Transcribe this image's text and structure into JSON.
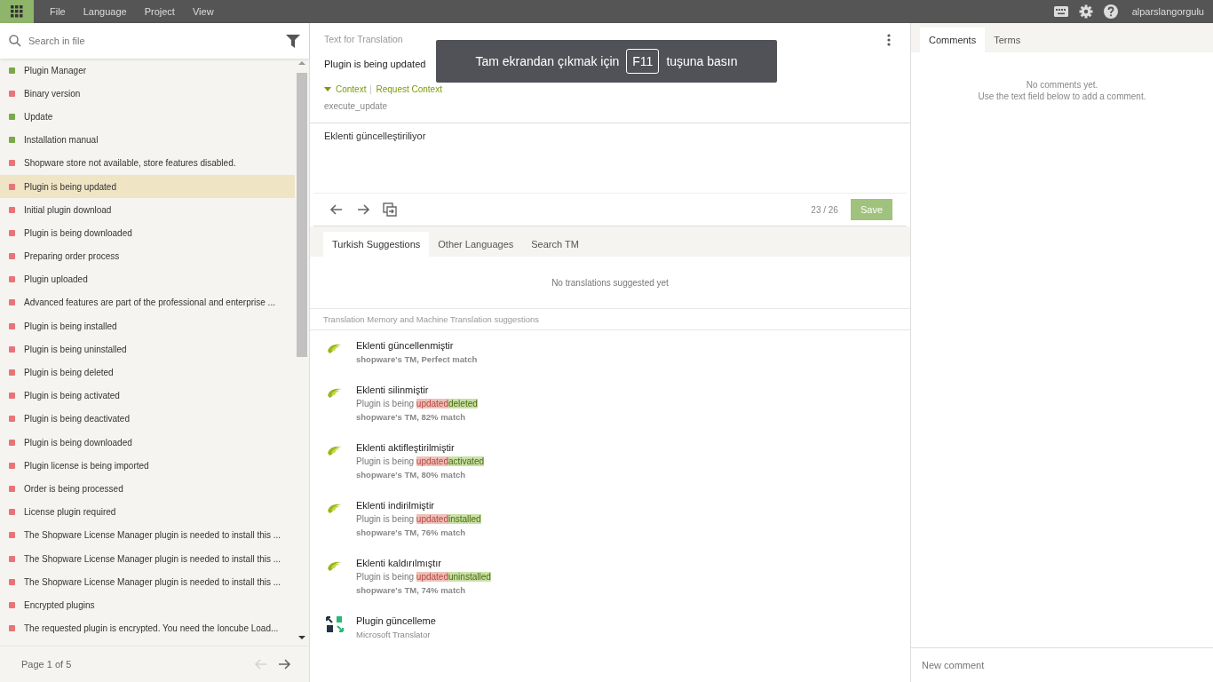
{
  "menu": [
    "File",
    "Language",
    "Project",
    "View"
  ],
  "user": "alparslangorgulu",
  "search": {
    "placeholder": "Search in file"
  },
  "strings": [
    {
      "text": "Plugin Manager",
      "translated": true,
      "selected": false
    },
    {
      "text": "Binary version",
      "translated": false,
      "selected": false
    },
    {
      "text": "Update",
      "translated": true,
      "selected": false
    },
    {
      "text": "Installation manual",
      "translated": true,
      "selected": false
    },
    {
      "text": "Shopware store not available, store features disabled.",
      "translated": false,
      "selected": false
    },
    {
      "text": "Plugin is being updated",
      "translated": false,
      "selected": true
    },
    {
      "text": "Initial plugin download",
      "translated": false,
      "selected": false
    },
    {
      "text": "Plugin is being downloaded",
      "translated": false,
      "selected": false
    },
    {
      "text": "Preparing order process",
      "translated": false,
      "selected": false
    },
    {
      "text": "Plugin uploaded",
      "translated": false,
      "selected": false
    },
    {
      "text": "Advanced features are part of the professional and enterprise ...",
      "translated": false,
      "selected": false
    },
    {
      "text": "Plugin is being installed",
      "translated": false,
      "selected": false
    },
    {
      "text": "Plugin is being uninstalled",
      "translated": false,
      "selected": false
    },
    {
      "text": "Plugin is being deleted",
      "translated": false,
      "selected": false
    },
    {
      "text": "Plugin is being activated",
      "translated": false,
      "selected": false
    },
    {
      "text": "Plugin is being deactivated",
      "translated": false,
      "selected": false
    },
    {
      "text": "Plugin is being downloaded",
      "translated": false,
      "selected": false
    },
    {
      "text": "Plugin license is being imported",
      "translated": false,
      "selected": false
    },
    {
      "text": "Order is being processed",
      "translated": false,
      "selected": false
    },
    {
      "text": "License plugin required",
      "translated": false,
      "selected": false
    },
    {
      "text": "The Shopware License Manager plugin is needed to install this ...",
      "translated": false,
      "selected": false
    },
    {
      "text": "The Shopware License Manager plugin is needed to install this ...",
      "translated": false,
      "selected": false
    },
    {
      "text": "The Shopware License Manager plugin is needed to install this ...",
      "translated": false,
      "selected": false
    },
    {
      "text": "Encrypted plugins",
      "translated": false,
      "selected": false
    },
    {
      "text": "The requested plugin is encrypted. You need the Ioncube Load...",
      "translated": false,
      "selected": false
    }
  ],
  "pagination": {
    "label": "Page 1 of 5",
    "prev_disabled": true,
    "next_disabled": false
  },
  "source": {
    "heading": "Text for Translation",
    "text": "Plugin is being updated",
    "context_toggle": "Context",
    "request_context": "Request Context",
    "context": "execute_update"
  },
  "translation": {
    "value": "Eklenti güncelleştiriliyor",
    "counter": "23 / 26",
    "save": "Save"
  },
  "fullscreen_notice": {
    "before": "Tam ekrandan çıkmak için",
    "key": "F11",
    "after": "tuşuna basın"
  },
  "suggestion_tabs": [
    {
      "label": "Turkish Suggestions",
      "selected": true
    },
    {
      "label": "Other Languages",
      "selected": false
    },
    {
      "label": "Search TM",
      "selected": false
    }
  ],
  "no_suggestions": "No translations suggested yet",
  "tm_heading": "Translation Memory and Machine Translation suggestions",
  "suggestions": [
    {
      "kind": "tm",
      "text": "Eklenti güncellenmiştir",
      "meta": "shopware's TM, Perfect match"
    },
    {
      "kind": "tm",
      "text": "Eklenti silinmiştir",
      "diff": {
        "same": "Plugin is being ",
        "removed": "updated",
        "added": "deleted"
      },
      "meta": "shopware's TM, 82% match"
    },
    {
      "kind": "tm",
      "text": "Eklenti aktifleştirilmiştir",
      "diff": {
        "same": "Plugin is being ",
        "removed": "updated",
        "added": "activated"
      },
      "meta": "shopware's TM, 80% match"
    },
    {
      "kind": "tm",
      "text": "Eklenti indirilmiştir",
      "diff": {
        "same": "Plugin is being ",
        "removed": "updated",
        "added": "installed"
      },
      "meta": "shopware's TM, 76% match"
    },
    {
      "kind": "tm",
      "text": "Eklenti kaldırılmıştır",
      "diff": {
        "same": "Plugin is being ",
        "removed": "updated",
        "added": "uninstalled"
      },
      "meta": "shopware's TM, 74% match"
    },
    {
      "kind": "mt",
      "text": "Plugin güncelleme",
      "meta": "Microsoft Translator"
    }
  ],
  "side_tabs": [
    {
      "label": "Comments",
      "selected": true
    },
    {
      "label": "Terms",
      "selected": false
    }
  ],
  "comments_empty": [
    "No comments yet.",
    "Use the text field below to add a comment."
  ],
  "comment_field": {
    "placeholder": "New comment"
  }
}
